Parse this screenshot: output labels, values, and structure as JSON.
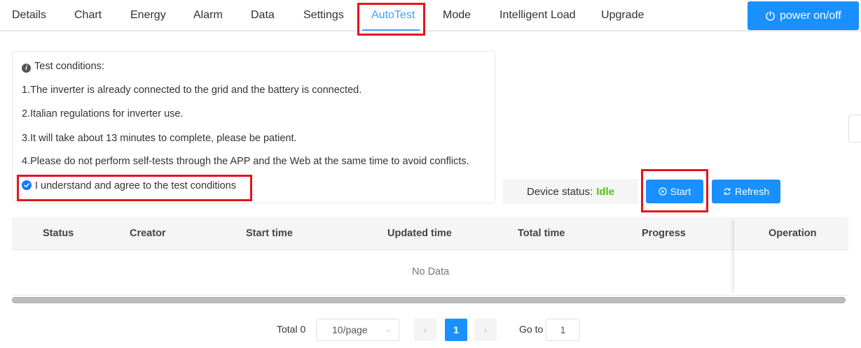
{
  "tabs": [
    {
      "label": "Details"
    },
    {
      "label": "Chart"
    },
    {
      "label": "Energy"
    },
    {
      "label": "Alarm"
    },
    {
      "label": "Data"
    },
    {
      "label": "Settings"
    },
    {
      "label": "AutoTest",
      "active": true
    },
    {
      "label": "Mode"
    },
    {
      "label": "Intelligent Load"
    },
    {
      "label": "Upgrade"
    }
  ],
  "power_button": {
    "label": "power on/off",
    "icon": "power-icon"
  },
  "conditions": {
    "title": "Test conditions:",
    "items": [
      "1.The inverter is already connected to the grid and the battery is connected.",
      "2.Italian regulations for inverter use.",
      "3.It will take about 13 minutes to complete, please be patient.",
      "4.Please do not perform self-tests through the APP and the Web at the same time to avoid conflicts."
    ],
    "agree_label": "I understand and agree to the test conditions",
    "agree_checked": true
  },
  "device_status": {
    "label": "Device status:",
    "value": "Idle"
  },
  "actions": {
    "start_label": "Start",
    "refresh_label": "Refresh"
  },
  "table": {
    "columns": [
      "Status",
      "Creator",
      "Start time",
      "Updated time",
      "Total time",
      "Progress",
      "Operation"
    ],
    "empty_text": "No Data"
  },
  "pagination": {
    "total_label": "Total 0",
    "page_size": "10/page",
    "current_page": "1",
    "goto_label": "Go to",
    "goto_value": "1"
  },
  "colors": {
    "primary": "#1890ff",
    "active_tab": "#409eff",
    "highlight": "#e4141c",
    "status_idle": "#52c41a"
  }
}
